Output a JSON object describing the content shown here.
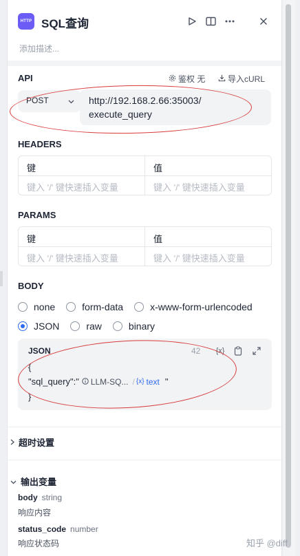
{
  "header": {
    "icon_text": "HTTP",
    "title": "SQL查询",
    "description_placeholder": "添加描述..."
  },
  "api": {
    "section_title": "API",
    "auth_label": "鉴权 无",
    "import_label": "导入cURL",
    "method": "POST",
    "url_line1": "http://192.168.2.66:35003/",
    "url_line2": "execute_query"
  },
  "headers": {
    "section_title": "HEADERS",
    "key_header": "键",
    "value_header": "值",
    "key_placeholder": "键入 '/' 键快速插入变量",
    "value_placeholder": "键入 '/' 键快速插入变量"
  },
  "params": {
    "section_title": "PARAMS",
    "key_header": "键",
    "value_header": "值",
    "key_placeholder": "键入 '/' 键快速插入变量",
    "value_placeholder": "键入 '/' 键快速插入变量"
  },
  "body": {
    "section_title": "BODY",
    "options_row1": [
      "none",
      "form-data",
      "x-www-form-urlencoded"
    ],
    "options_row2": [
      "JSON",
      "raw",
      "binary"
    ],
    "selected": "JSON",
    "json_label": "JSON",
    "char_count": "42",
    "code_open": "{",
    "code_key": "\"sql_query\":\"",
    "var_node": "LLM-SQ...",
    "var_sep": "/",
    "var_name": "text",
    "code_tail": "\"",
    "code_close": "}"
  },
  "timeout": {
    "label": "超时设置"
  },
  "outputs": {
    "label": "输出变量",
    "items": [
      {
        "name": "body",
        "type": "string",
        "desc": "响应内容"
      },
      {
        "name": "status_code",
        "type": "number",
        "desc": "响应状态码"
      }
    ]
  },
  "watermark": "知乎 @diff",
  "colors": {
    "accent": "#2f6bf0",
    "icon_bg": "#6b5cf6",
    "annotation": "#d83a3a"
  }
}
